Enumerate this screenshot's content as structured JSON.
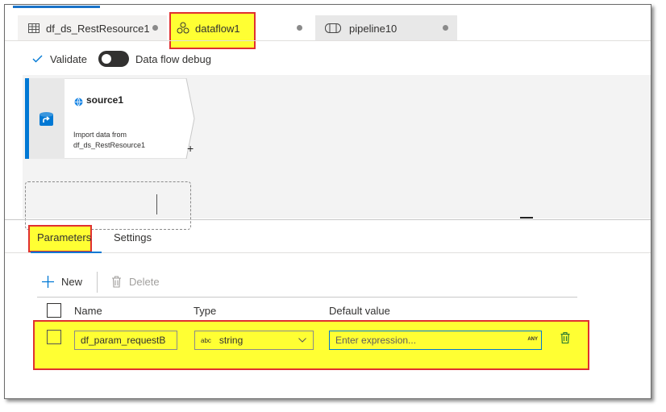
{
  "tabs": [
    {
      "label": "df_ds_RestResource1",
      "icon": "table-icon"
    },
    {
      "label": "dataflow1",
      "icon": "dataflow-icon"
    },
    {
      "label": "pipeline10",
      "icon": "pipeline-icon"
    }
  ],
  "toolbar": {
    "validate_label": "Validate",
    "debug_label": "Data flow debug",
    "debug_on": false
  },
  "canvas": {
    "source": {
      "name": "source1",
      "desc_line1": "Import data from",
      "desc_line2": "df_ds_RestResource1",
      "add_symbol": "+"
    }
  },
  "panel": {
    "tabs": [
      {
        "label": "Parameters",
        "active": true
      },
      {
        "label": "Settings",
        "active": false
      }
    ],
    "actions": {
      "new_label": "New",
      "delete_label": "Delete"
    },
    "columns": {
      "name": "Name",
      "type": "Type",
      "default": "Default value"
    },
    "rows": [
      {
        "name": "df_param_requestB",
        "type_badge": "abc",
        "type": "string",
        "default_placeholder": "Enter expression...",
        "any_badge": "ANY"
      }
    ]
  },
  "colors": {
    "accent": "#0078d4",
    "highlight": "#ffff33",
    "highlight_border": "#e03030"
  }
}
